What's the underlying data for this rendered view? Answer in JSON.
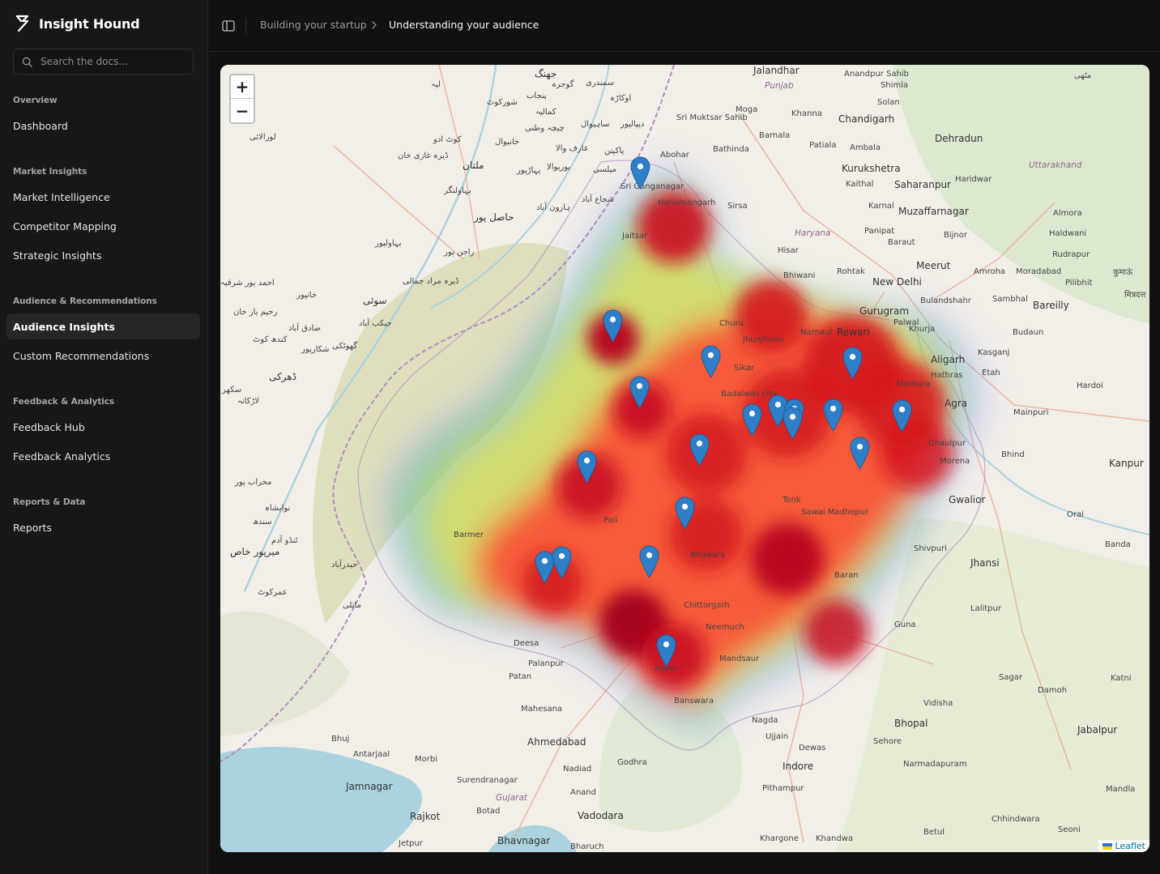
{
  "app": {
    "name": "Insight Hound"
  },
  "search": {
    "placeholder": "Search the docs..."
  },
  "nav": {
    "sections": [
      {
        "title": "Overview",
        "items": [
          {
            "label": "Dashboard"
          }
        ]
      },
      {
        "title": "Market Insights",
        "items": [
          {
            "label": "Market Intelligence"
          },
          {
            "label": "Competitor Mapping"
          },
          {
            "label": "Strategic Insights"
          }
        ]
      },
      {
        "title": "Audience & Recommendations",
        "items": [
          {
            "label": "Audience Insights",
            "active": true
          },
          {
            "label": "Custom Recommendations"
          }
        ]
      },
      {
        "title": "Feedback & Analytics",
        "items": [
          {
            "label": "Feedback Hub"
          },
          {
            "label": "Feedback Analytics"
          }
        ]
      },
      {
        "title": "Reports & Data",
        "items": [
          {
            "label": "Reports"
          }
        ]
      }
    ]
  },
  "breadcrumb": {
    "parent": "Building your startup",
    "current": "Understanding your audience"
  },
  "map": {
    "zoom_in": "+",
    "zoom_out": "−",
    "attribution": "Leaflet",
    "marker_color": "#2f7fc8",
    "heat_colors": [
      "#0000ff",
      "#00ff00",
      "#ffff00",
      "#ff0000",
      "#b00020"
    ],
    "places": [
      "Jalandhar",
      "Punjab",
      "Anandpur Sahib",
      "Shimla",
      "Solan",
      "Moga",
      "Khanna",
      "Chandigarh",
      "Dehradun",
      "Sri Muktsar Sahib",
      "Bathinda",
      "Barnala",
      "Patiala",
      "Ambala",
      "Abohar",
      "Kurukshetra",
      "Haridwar",
      "Uttarakhand",
      "Sri Ganganagar",
      "Hanumangarh",
      "Sirsa",
      "Kaithal",
      "Saharanpur",
      "Karnal",
      "Muzaffarnagar",
      "Almora",
      "Jaitsar",
      "Haryana",
      "Panipat",
      "Bijnor",
      "Haldwani",
      "Hisar",
      "Baraut",
      "Rudrapur",
      "Meerut",
      "Bhiwani",
      "Rohtak",
      "New Delhi",
      "Amroha",
      "Moradabad",
      "Pilibhit",
      "Gurugram",
      "Bulandshahr",
      "Sambhal",
      "Bareilly",
      "Churu",
      "Jhunjhunu",
      "Narnaul",
      "Rewari",
      "Palwal",
      "Khurja",
      "Budaun",
      "Aligarh",
      "Kasganj",
      "Sikar",
      "Mathura",
      "Hathras",
      "Etah",
      "Hardoi",
      "Badalwas city",
      "Agra",
      "Mainpuri",
      "Dhaulpur",
      "Morena",
      "Bhind",
      "Kanpur",
      "Tonk",
      "Sawai Madhopur",
      "Gwalior",
      "Orai",
      "Barmer",
      "Pali",
      "Shivpuri",
      "Banda",
      "Bhilwara",
      "Jhansi",
      "Baran",
      "Lalitpur",
      "Chittorgarh",
      "Neemuch",
      "Guna",
      "Deesa",
      "Palanpur",
      "Mandsaur",
      "Aspur",
      "Patan",
      "Sagar",
      "Katni",
      "Banswara",
      "Damoh",
      "Mahesana",
      "Vidisha",
      "Nagda",
      "Bhopal",
      "Ujjain",
      "Sehore",
      "Jabalpur",
      "Bhuj",
      "Ahmedabad",
      "Dewas",
      "Antarjaal",
      "Morbi",
      "Indore",
      "Narmadapuram",
      "Nadiad",
      "Godhra",
      "Jamnagar",
      "Surendranagar",
      "Anand",
      "Pithampur",
      "Mandla",
      "Gujarat",
      "Rajkot",
      "Botad",
      "Vadodara",
      "Chhindwara",
      "Seoni",
      "Betul",
      "Khargone",
      "Khandwa",
      "Jetpur",
      "Bhavnagar",
      "Bharuch",
      "جهنگ",
      "لیہ",
      "گوجرہ",
      "سمندری",
      "پنجاب",
      "اوکاڑہ",
      "شورکوٹ",
      "کمالیہ",
      "لورالائی",
      "کوٹ ادو",
      "ساہیوال",
      "دیپالپور",
      "چیچہ وطنی",
      "خانیوال",
      "عارف والا",
      "پاکپتن",
      "ڈیرہ غازی خان",
      "ملتان",
      "بوریوالا",
      "پہاڑپور",
      "میلسی",
      "بہاولنگر",
      "شجاع آباد",
      "ہارون آباد",
      "حاصل پور",
      "بہاولپور",
      "راجن پور",
      "احمد پور شرقیہ",
      "ڈیرہ مراد جمالی",
      "خانپور",
      "سوئی",
      "رحیم یار خان",
      "جیکب آباد",
      "صادق آباد",
      "کندھ کوٹ",
      "شکارپور",
      "گھوٹکی",
      "ڈھرکی",
      "سکھر",
      "لاڑکانہ",
      "محراب پور",
      "نوابشاہ",
      "سندھ",
      "ٹنڈو آدم",
      "میرپور خاص",
      "حیدرآباد",
      "عمرکوٹ",
      "ماتلی",
      "مٹھی",
      "कुमाऊं",
      "मित्रदत्त",
      "बरेली"
    ]
  }
}
